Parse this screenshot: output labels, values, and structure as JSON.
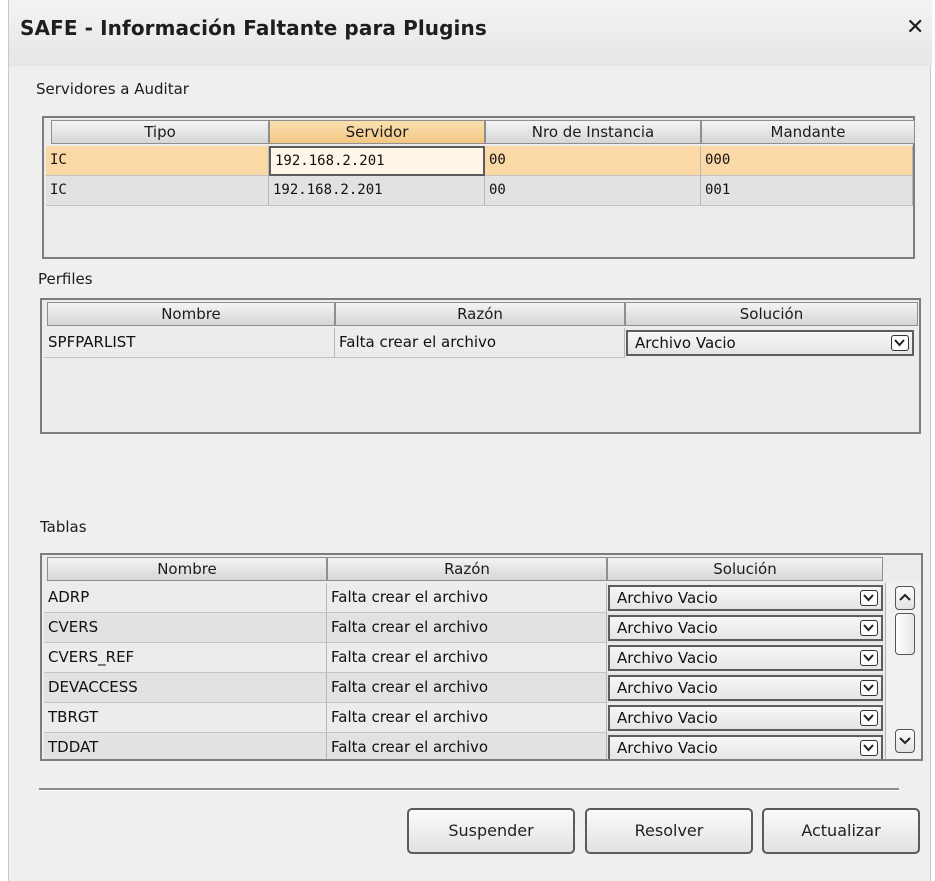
{
  "window": {
    "title": "SAFE - Información Faltante para Plugins"
  },
  "servers": {
    "label": "Servidores a Auditar",
    "columns": [
      "Tipo",
      "Servidor",
      "Nro de Instancia",
      "Mandante"
    ],
    "rows": [
      [
        "IC",
        "192.168.2.201",
        "00",
        "000"
      ],
      [
        "IC",
        "192.168.2.201",
        "00",
        "001"
      ]
    ]
  },
  "profiles": {
    "label": "Perfiles",
    "columns": [
      "Nombre",
      "Razón",
      "Solución"
    ],
    "rows": [
      [
        "SPFPARLIST",
        "Falta crear el archivo",
        "Archivo Vacio"
      ]
    ]
  },
  "tables": {
    "label": "Tablas",
    "columns": [
      "Nombre",
      "Razón",
      "Solución"
    ],
    "rows": [
      [
        "ADRP",
        "Falta crear el archivo",
        "Archivo Vacio"
      ],
      [
        "CVERS",
        "Falta crear el archivo",
        "Archivo Vacio"
      ],
      [
        "CVERS_REF",
        "Falta crear el archivo",
        "Archivo Vacio"
      ],
      [
        "DEVACCESS",
        "Falta crear el archivo",
        "Archivo Vacio"
      ],
      [
        "TBRGT",
        "Falta crear el archivo",
        "Archivo Vacio"
      ],
      [
        "TDDAT",
        "Falta crear el archivo",
        "Archivo Vacio"
      ]
    ]
  },
  "buttons": {
    "suspend": "Suspender",
    "resolve": "Resolver",
    "refresh": "Actualizar"
  },
  "colors": {
    "selected_row": "#fbd9a6",
    "active_header": "#f3c784",
    "dialog_bg": "#efefef"
  },
  "icons": {
    "close": "close-icon",
    "dropdown": "chevron-down-icon",
    "scroll_up": "arrow-up-icon",
    "scroll_down": "arrow-down-icon"
  }
}
